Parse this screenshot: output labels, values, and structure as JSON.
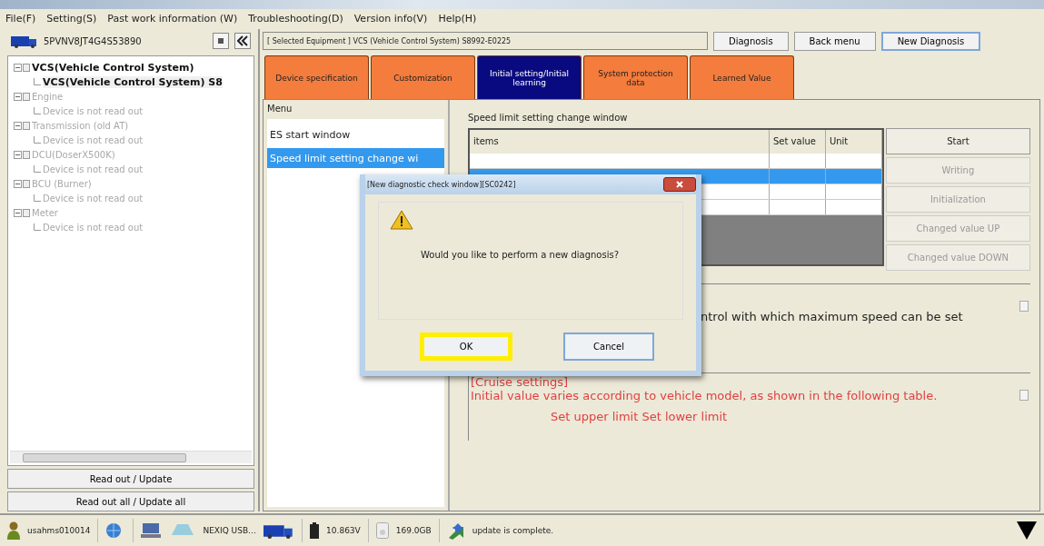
{
  "menu_bar": [
    "File(F)",
    "Setting(S)",
    "Past work information (W)",
    "Troubleshooting(D)",
    "Version info(V)",
    "Help(H)"
  ],
  "left_panel": {
    "vin": "5PVNV8JT4G4S53890",
    "tree": [
      {
        "label": "VCS(Vehicle Control System)",
        "disabled": false,
        "children": [
          {
            "label": "VCS(Vehicle Control System) S8",
            "disabled": false
          }
        ]
      },
      {
        "label": "Engine",
        "disabled": true,
        "children": [
          {
            "label": "Device is not read out",
            "disabled": true
          }
        ]
      },
      {
        "label": "Transmission (old AT)",
        "disabled": true,
        "children": [
          {
            "label": "Device is not read out",
            "disabled": true
          }
        ]
      },
      {
        "label": "DCU(DoserX500K)",
        "disabled": true,
        "children": [
          {
            "label": "Device is not read out",
            "disabled": true
          }
        ]
      },
      {
        "label": "BCU (Burner)",
        "disabled": true,
        "children": [
          {
            "label": "Device is not read out",
            "disabled": true
          }
        ]
      },
      {
        "label": "Meter",
        "disabled": true,
        "children": [
          {
            "label": "Device is not read out",
            "disabled": true
          }
        ]
      }
    ],
    "buttons": [
      "Read out / Update",
      "Read out all / Update all"
    ]
  },
  "header": {
    "selected_equipment": "[ Selected Equipment ] VCS (Vehicle Control System) S8992-E0225",
    "buttons": [
      {
        "label": "Diagnosis",
        "focused": false
      },
      {
        "label": "Back menu",
        "focused": false
      },
      {
        "label": "New Diagnosis",
        "focused": true
      }
    ]
  },
  "tabs": [
    {
      "label": "Device specification",
      "selected": false
    },
    {
      "label": "Customization",
      "selected": false
    },
    {
      "label": "Initial setting/Initial learning",
      "selected": true
    },
    {
      "label": "System protection data",
      "selected": false
    },
    {
      "label": "Learned Value",
      "selected": false
    }
  ],
  "menu": {
    "title": "Menu",
    "items": [
      {
        "label": "ES start window",
        "selected": false
      },
      {
        "label": "Speed limit setting change wi",
        "selected": true
      }
    ]
  },
  "content": {
    "title": "Speed limit setting change window",
    "table": {
      "columns": [
        "items",
        "Set value",
        "Unit"
      ],
      "rows": [
        {
          "selected": false
        },
        {
          "selected": true
        },
        {
          "selected": false
        },
        {
          "selected": false
        }
      ]
    },
    "buttons": [
      {
        "label": "Start",
        "disabled": false
      },
      {
        "label": "Writing",
        "disabled": true
      },
      {
        "label": "Initialization",
        "disabled": true
      },
      {
        "label": "Changed value UP",
        "disabled": true
      },
      {
        "label": "Changed value DOWN",
        "disabled": true
      }
    ],
    "description": "ntrol with which maximum speed can be set",
    "caution": [
      "[Cruise settings]",
      "Initial value varies according to vehicle model, as shown in the following table.",
      "Set upper limit  Set lower limit"
    ]
  },
  "dialog": {
    "title": "[New diagnostic check window][SC0242]",
    "message": "Would you like to perform a new diagnosis?",
    "buttons": [
      {
        "label": "OK",
        "highlighted": true
      },
      {
        "label": "Cancel",
        "highlighted": false
      }
    ]
  },
  "status_bar": {
    "user": "usahms010014",
    "device": "NEXIQ USB…",
    "voltage": "10.863V",
    "disk": "169.0GB",
    "message": "update is complete."
  }
}
